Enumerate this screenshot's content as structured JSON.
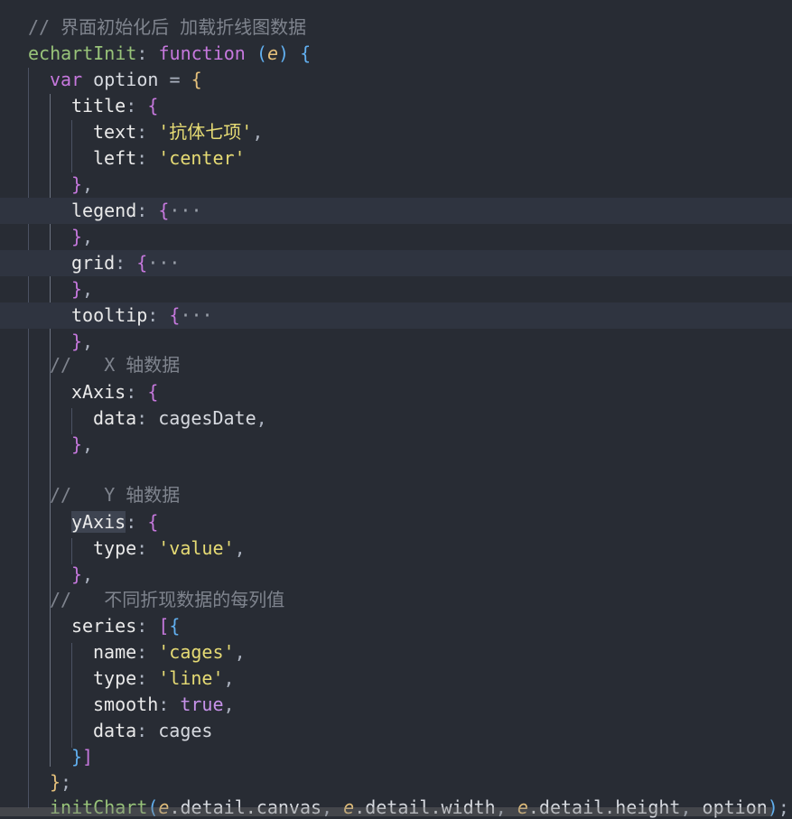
{
  "editor": {
    "lines": [
      {
        "comment": "// 界面初始化后 加载折线图数据"
      },
      {
        "fn": "echartInit",
        "colon": ":",
        "kw": "function",
        "open_paren": "(",
        "param": "e",
        "close_paren": ")",
        "brace": "{"
      },
      {
        "kw": "var",
        "ident": "option",
        "eq": "=",
        "brace": "{"
      },
      {
        "prop": "title",
        "colon": ":",
        "brace": "{"
      },
      {
        "prop": "text",
        "colon": ":",
        "str": "'抗体七项'",
        "comma": ","
      },
      {
        "prop": "left",
        "colon": ":",
        "str": "'center'"
      },
      {
        "brace": "}",
        "comma": ","
      },
      {
        "prop": "legend",
        "colon": ":",
        "brace": "{",
        "fold": "···"
      },
      {
        "brace": "}",
        "comma": ","
      },
      {
        "prop": "grid",
        "colon": ":",
        "brace": "{",
        "fold": "···"
      },
      {
        "brace": "}",
        "comma": ","
      },
      {
        "prop": "tooltip",
        "colon": ":",
        "brace": "{",
        "fold": "···"
      },
      {
        "brace": "}",
        "comma": ","
      },
      {
        "comment": "//   X 轴数据"
      },
      {
        "prop": "xAxis",
        "colon": ":",
        "brace": "{"
      },
      {
        "prop": "data",
        "colon": ":",
        "ident": "cagesDate",
        "comma": ","
      },
      {
        "brace": "}",
        "comma": ","
      },
      {},
      {
        "comment": "//   Y 轴数据"
      },
      {
        "prop": "yAxis",
        "colon": ":",
        "brace": "{"
      },
      {
        "prop": "type",
        "colon": ":",
        "str": "'value'",
        "comma": ","
      },
      {
        "brace": "}",
        "comma": ","
      },
      {
        "comment": "//   不同折现数据的每列值"
      },
      {
        "prop": "series",
        "colon": ":",
        "bracket": "[",
        "brace": "{"
      },
      {
        "prop": "name",
        "colon": ":",
        "str": "'cages'",
        "comma": ","
      },
      {
        "prop": "type",
        "colon": ":",
        "str": "'line'",
        "comma": ","
      },
      {
        "prop": "smooth",
        "colon": ":",
        "bool": "true",
        "comma": ","
      },
      {
        "prop": "data",
        "colon": ":",
        "ident": "cages"
      },
      {
        "brace": "}",
        "bracket": "]"
      },
      {
        "brace": "}",
        "semi": ";"
      },
      {
        "fn": "initChart",
        "open_paren": "(",
        "arg1_param": "e",
        "arg1_rest": ".detail.canvas",
        "c1": ",",
        "arg2_param": "e",
        "arg2_rest": ".detail.width",
        "c2": ",",
        "arg3_param": "e",
        "arg3_rest": ".detail.height",
        "c3": ",",
        "arg4": "option",
        "close_paren": ")",
        "semi": ";"
      }
    ]
  }
}
